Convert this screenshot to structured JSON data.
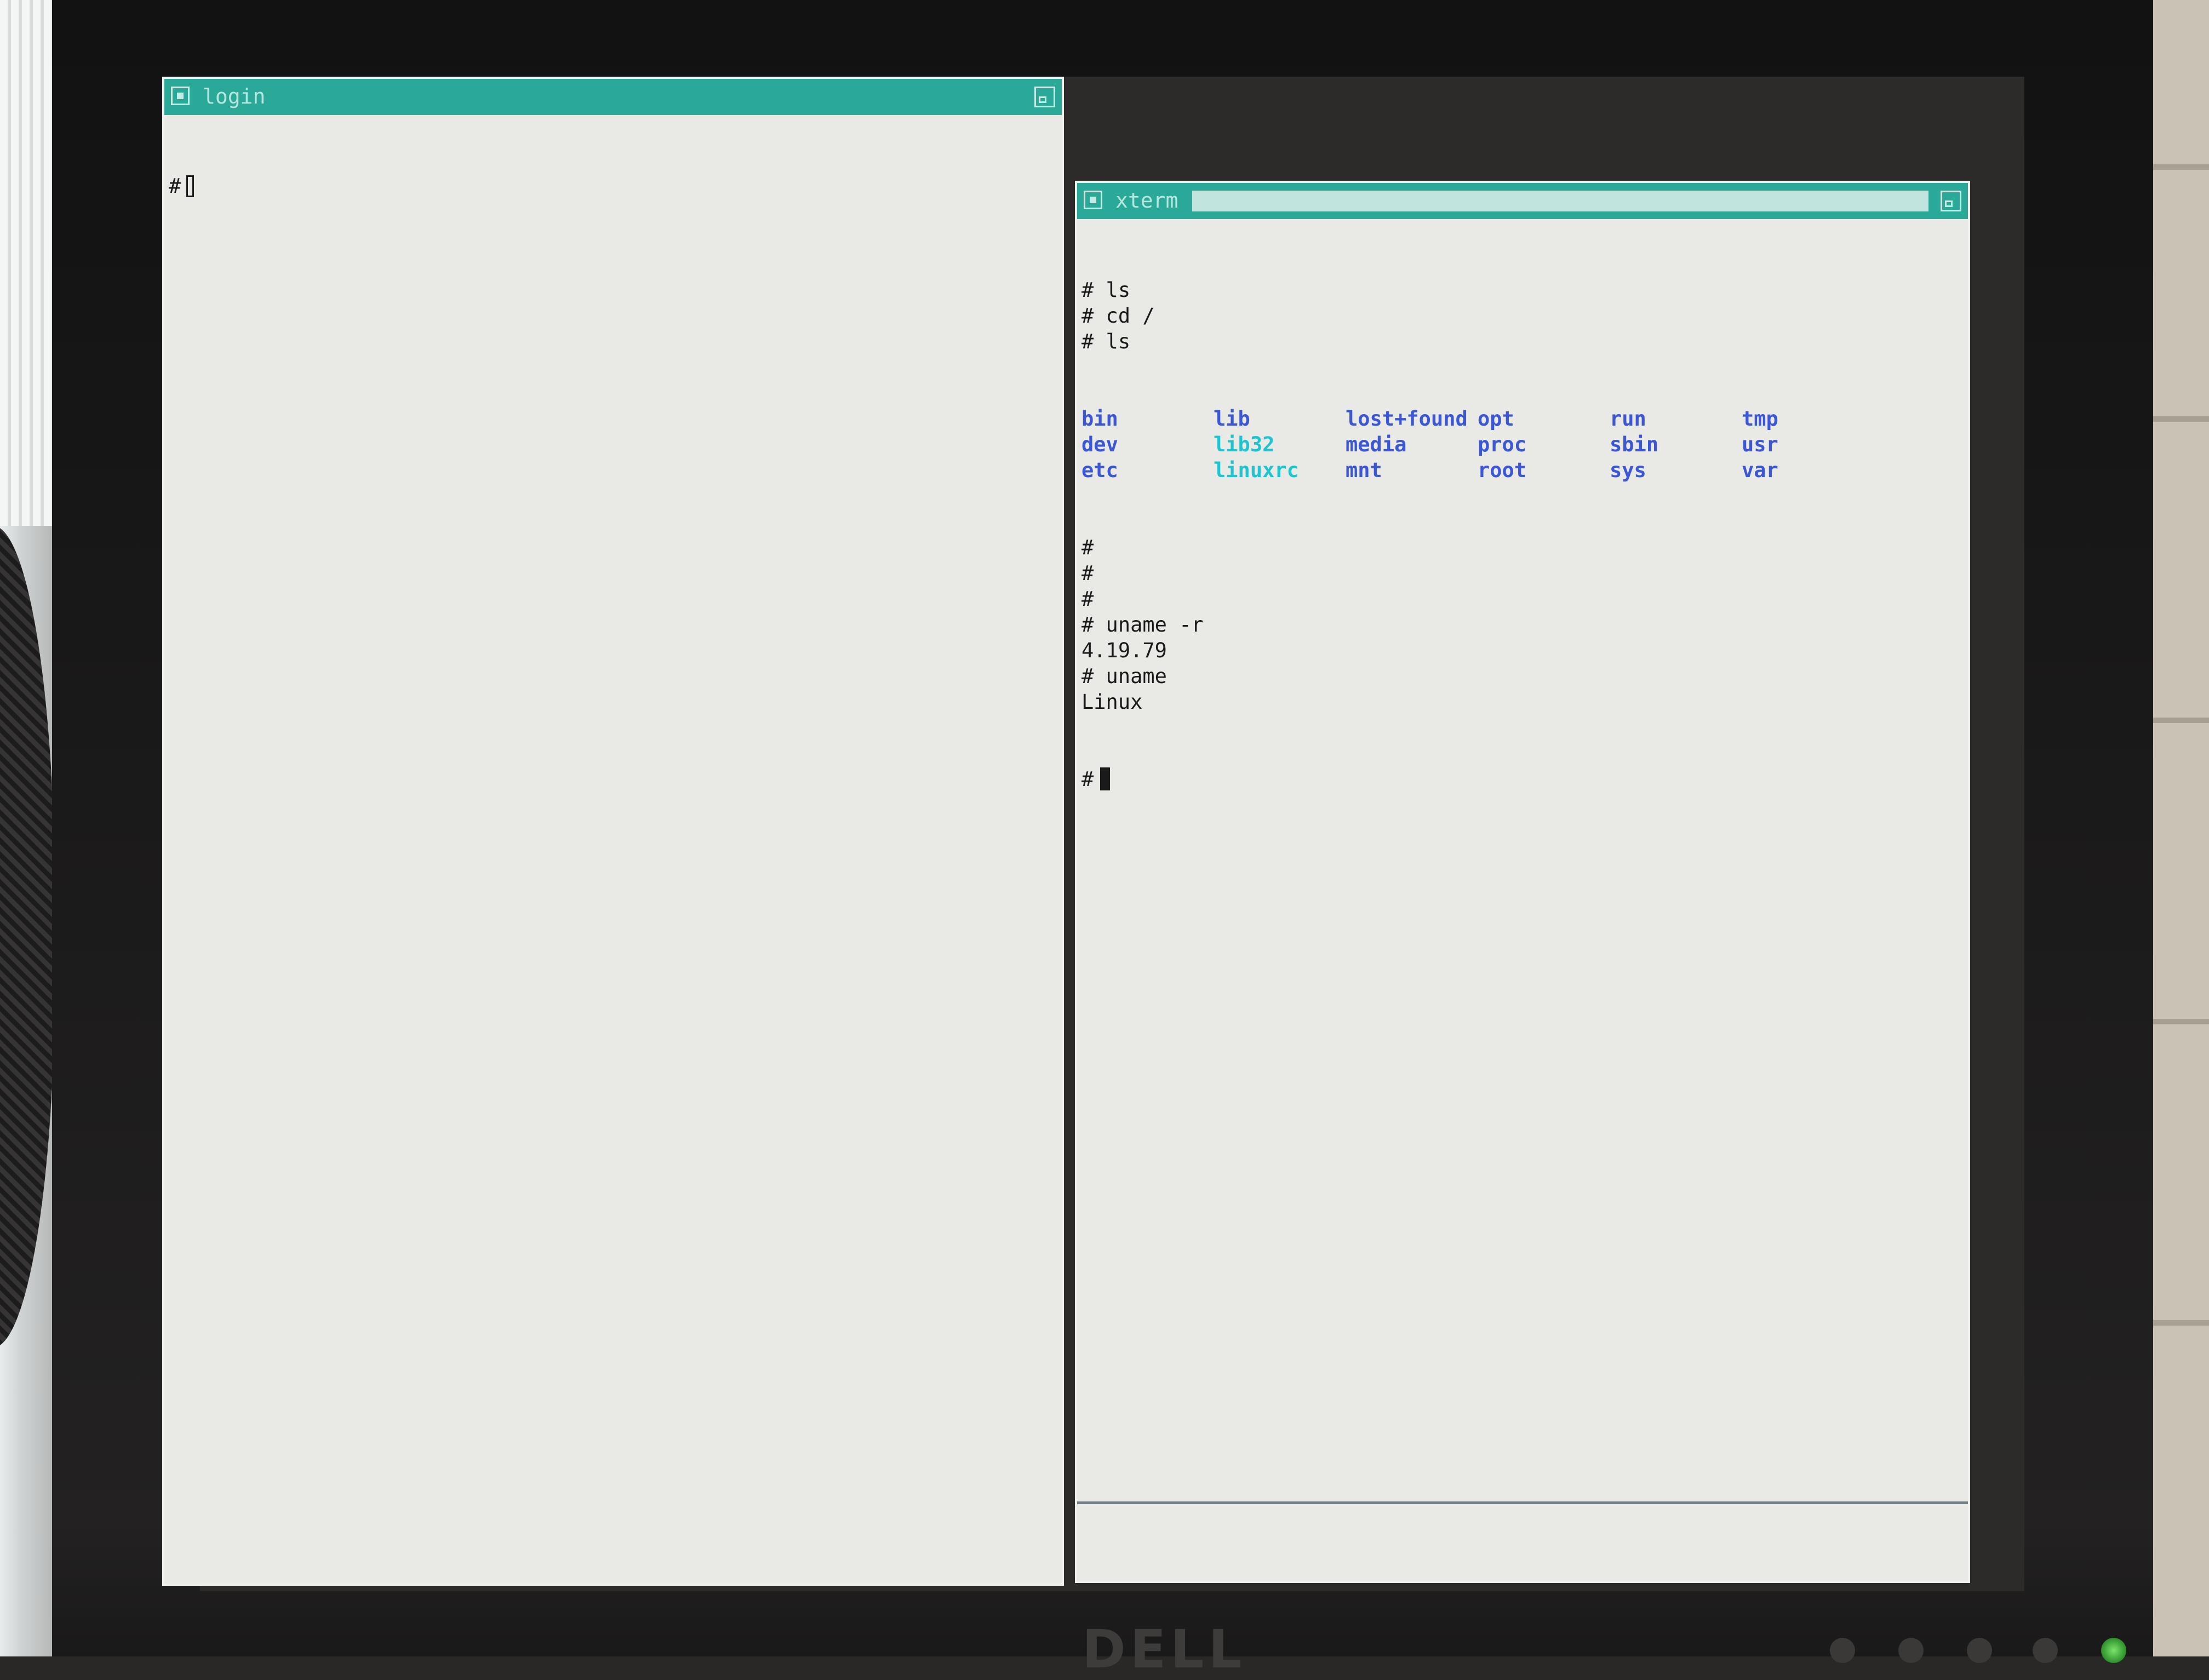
{
  "windows": {
    "login": {
      "title": "login",
      "prompt": "#"
    },
    "xterm": {
      "title": "xterm",
      "lines": [
        {
          "text": "# ls"
        },
        {
          "text": "# cd /"
        },
        {
          "text": "# ls"
        }
      ],
      "ls_listing": [
        {
          "name": "bin",
          "kind": "dir"
        },
        {
          "name": "lib",
          "kind": "dir"
        },
        {
          "name": "lost+found",
          "kind": "dir"
        },
        {
          "name": "opt",
          "kind": "dir"
        },
        {
          "name": "run",
          "kind": "dir"
        },
        {
          "name": "tmp",
          "kind": "dir"
        },
        {
          "name": "dev",
          "kind": "dir"
        },
        {
          "name": "lib32",
          "kind": "link"
        },
        {
          "name": "media",
          "kind": "dir"
        },
        {
          "name": "proc",
          "kind": "dir"
        },
        {
          "name": "sbin",
          "kind": "dir"
        },
        {
          "name": "usr",
          "kind": "dir"
        },
        {
          "name": "etc",
          "kind": "dir"
        },
        {
          "name": "linuxrc",
          "kind": "link"
        },
        {
          "name": "mnt",
          "kind": "dir"
        },
        {
          "name": "root",
          "kind": "dir"
        },
        {
          "name": "sys",
          "kind": "dir"
        },
        {
          "name": "var",
          "kind": "dir"
        }
      ],
      "after_lines": [
        {
          "text": "#"
        },
        {
          "text": "#"
        },
        {
          "text": "#"
        },
        {
          "text": "# uname -r"
        },
        {
          "text": "4.19.79"
        },
        {
          "text": "# uname"
        },
        {
          "text": "Linux"
        }
      ],
      "prompt": "#"
    }
  },
  "colors": {
    "titlebar": "#2aa898",
    "terminal_background": "#e9e9e6",
    "directory": "#3b57d6",
    "symlink": "#1fc4d1"
  },
  "icons": {
    "window_menu": "window-menu-icon",
    "window_resize": "window-resize-icon"
  },
  "monitor": {
    "brand": "DELL"
  }
}
